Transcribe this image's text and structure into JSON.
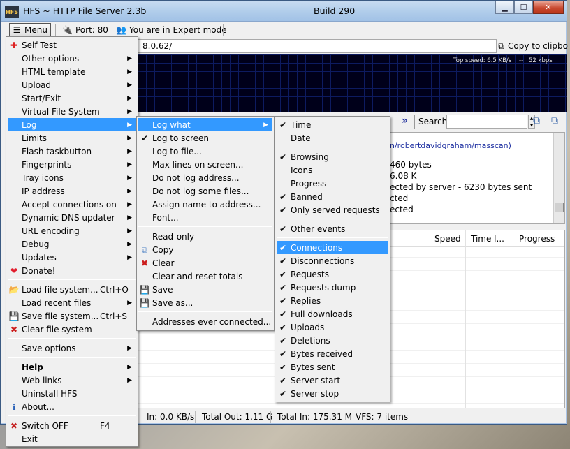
{
  "window": {
    "title": "HFS ~ HTTP File Server 2.3b",
    "build": "Build 290",
    "logo_text": "HFS",
    "buttons": {
      "minimize": "▁",
      "maximize": "☐",
      "close": "✕"
    }
  },
  "toolbar": {
    "menu_label": "Menu",
    "port_label": "Port: 80",
    "mode_label": "You are in Expert mode"
  },
  "url": {
    "value": "8.0.62/"
  },
  "copy_clipboard_label": "Copy to clipbo",
  "graph": {
    "top_speed": "Top speed: 6.5 KB/s",
    "rate": "52 kbps"
  },
  "search": {
    "label": "Search",
    "value": ""
  },
  "log_lines": [
    "n/robertdavidgraham/masscan)",
    "460 bytes",
    "6.08 K",
    "ected by server - 6230 bytes sent",
    "cted",
    "ected"
  ],
  "connections": {
    "columns": [
      "Speed",
      "Time l...",
      "Progress"
    ]
  },
  "status": {
    "in_rate": "In: 0.0 KB/s",
    "total_out": "Total Out: 1.11 G",
    "total_in": "Total In: 175.31 M",
    "vfs": "VFS: 7 items"
  },
  "main_menu": {
    "items": [
      {
        "label": "Self Test",
        "icon": "self-test-icon",
        "glyph": "✚"
      },
      {
        "label": "Other options",
        "submenu": true
      },
      {
        "label": "HTML template",
        "submenu": true
      },
      {
        "label": "Upload",
        "submenu": true
      },
      {
        "label": "Start/Exit",
        "submenu": true
      },
      {
        "label": "Virtual File System",
        "submenu": true
      },
      {
        "label": "Log",
        "submenu": true,
        "highlighted": true
      },
      {
        "label": "Limits",
        "submenu": true
      },
      {
        "label": "Flash taskbutton",
        "submenu": true
      },
      {
        "label": "Fingerprints",
        "submenu": true
      },
      {
        "label": "Tray icons",
        "submenu": true
      },
      {
        "label": "IP address",
        "submenu": true
      },
      {
        "label": "Accept connections on",
        "submenu": true
      },
      {
        "label": "Dynamic DNS updater",
        "submenu": true
      },
      {
        "label": "URL encoding",
        "submenu": true
      },
      {
        "label": "Debug",
        "submenu": true
      },
      {
        "label": "Updates",
        "submenu": true
      },
      {
        "label": "Donate!",
        "icon": "heart-icon",
        "glyph": "❤"
      },
      {
        "separator": true
      },
      {
        "label": "Load file system...",
        "shortcut": "Ctrl+O",
        "icon": "folder-open-icon",
        "glyph": "📂"
      },
      {
        "label": "Load recent files",
        "submenu": true
      },
      {
        "label": "Save file system...",
        "shortcut": "Ctrl+S",
        "icon": "floppy-icon",
        "glyph": "💾"
      },
      {
        "label": "Clear file system",
        "icon": "red-x-icon",
        "glyph": "✖"
      },
      {
        "separator": true
      },
      {
        "label": "Save options",
        "submenu": true
      },
      {
        "separator": true
      },
      {
        "label": "Help",
        "submenu": true,
        "bold": true
      },
      {
        "label": "Web links",
        "submenu": true
      },
      {
        "label": "Uninstall HFS"
      },
      {
        "label": "About...",
        "icon": "info-icon",
        "glyph": "ℹ"
      },
      {
        "separator": true
      },
      {
        "label": "Switch OFF",
        "shortcut": "F4",
        "icon": "switch-off-icon",
        "glyph": "✖"
      },
      {
        "label": "Exit"
      }
    ]
  },
  "log_menu": {
    "items": [
      {
        "label": "Log what",
        "submenu": true,
        "highlighted": true
      },
      {
        "label": "Log to screen",
        "checked": true
      },
      {
        "label": "Log to file..."
      },
      {
        "label": "Max lines on screen..."
      },
      {
        "label": "Do not log address..."
      },
      {
        "label": "Do not log some files..."
      },
      {
        "label": "Assign name to address..."
      },
      {
        "label": "Font..."
      },
      {
        "separator": true
      },
      {
        "label": "Read-only"
      },
      {
        "label": "Copy",
        "icon": "copy-icon",
        "glyph": "⧉"
      },
      {
        "label": "Clear",
        "icon": "red-x-icon",
        "glyph": "✖"
      },
      {
        "label": "Clear and reset totals"
      },
      {
        "label": "Save",
        "icon": "floppy-icon",
        "glyph": "💾"
      },
      {
        "label": "Save as...",
        "icon": "floppy-icon",
        "glyph": "💾"
      },
      {
        "separator": true
      },
      {
        "label": "Addresses ever connected..."
      }
    ]
  },
  "log_what_menu": {
    "items": [
      {
        "label": "Time",
        "checked": true
      },
      {
        "label": "Date",
        "checked": false
      },
      {
        "separator": true
      },
      {
        "label": "Browsing",
        "checked": true
      },
      {
        "label": "Icons",
        "checked": false
      },
      {
        "label": "Progress",
        "checked": false
      },
      {
        "label": "Banned",
        "checked": true
      },
      {
        "label": "Only served requests",
        "checked": true
      },
      {
        "separator": true
      },
      {
        "label": "Other events",
        "checked": true
      },
      {
        "separator": true
      },
      {
        "label": "Connections",
        "checked": true,
        "highlighted": true
      },
      {
        "label": "Disconnections",
        "checked": true
      },
      {
        "label": "Requests",
        "checked": true
      },
      {
        "label": "Requests dump",
        "checked": true
      },
      {
        "label": "Replies",
        "checked": true
      },
      {
        "label": "Full downloads",
        "checked": true
      },
      {
        "label": "Uploads",
        "checked": true
      },
      {
        "label": "Deletions",
        "checked": true
      },
      {
        "label": "Bytes received",
        "checked": true
      },
      {
        "label": "Bytes sent",
        "checked": true
      },
      {
        "label": "Server start",
        "checked": true
      },
      {
        "label": "Server stop",
        "checked": true
      }
    ]
  }
}
